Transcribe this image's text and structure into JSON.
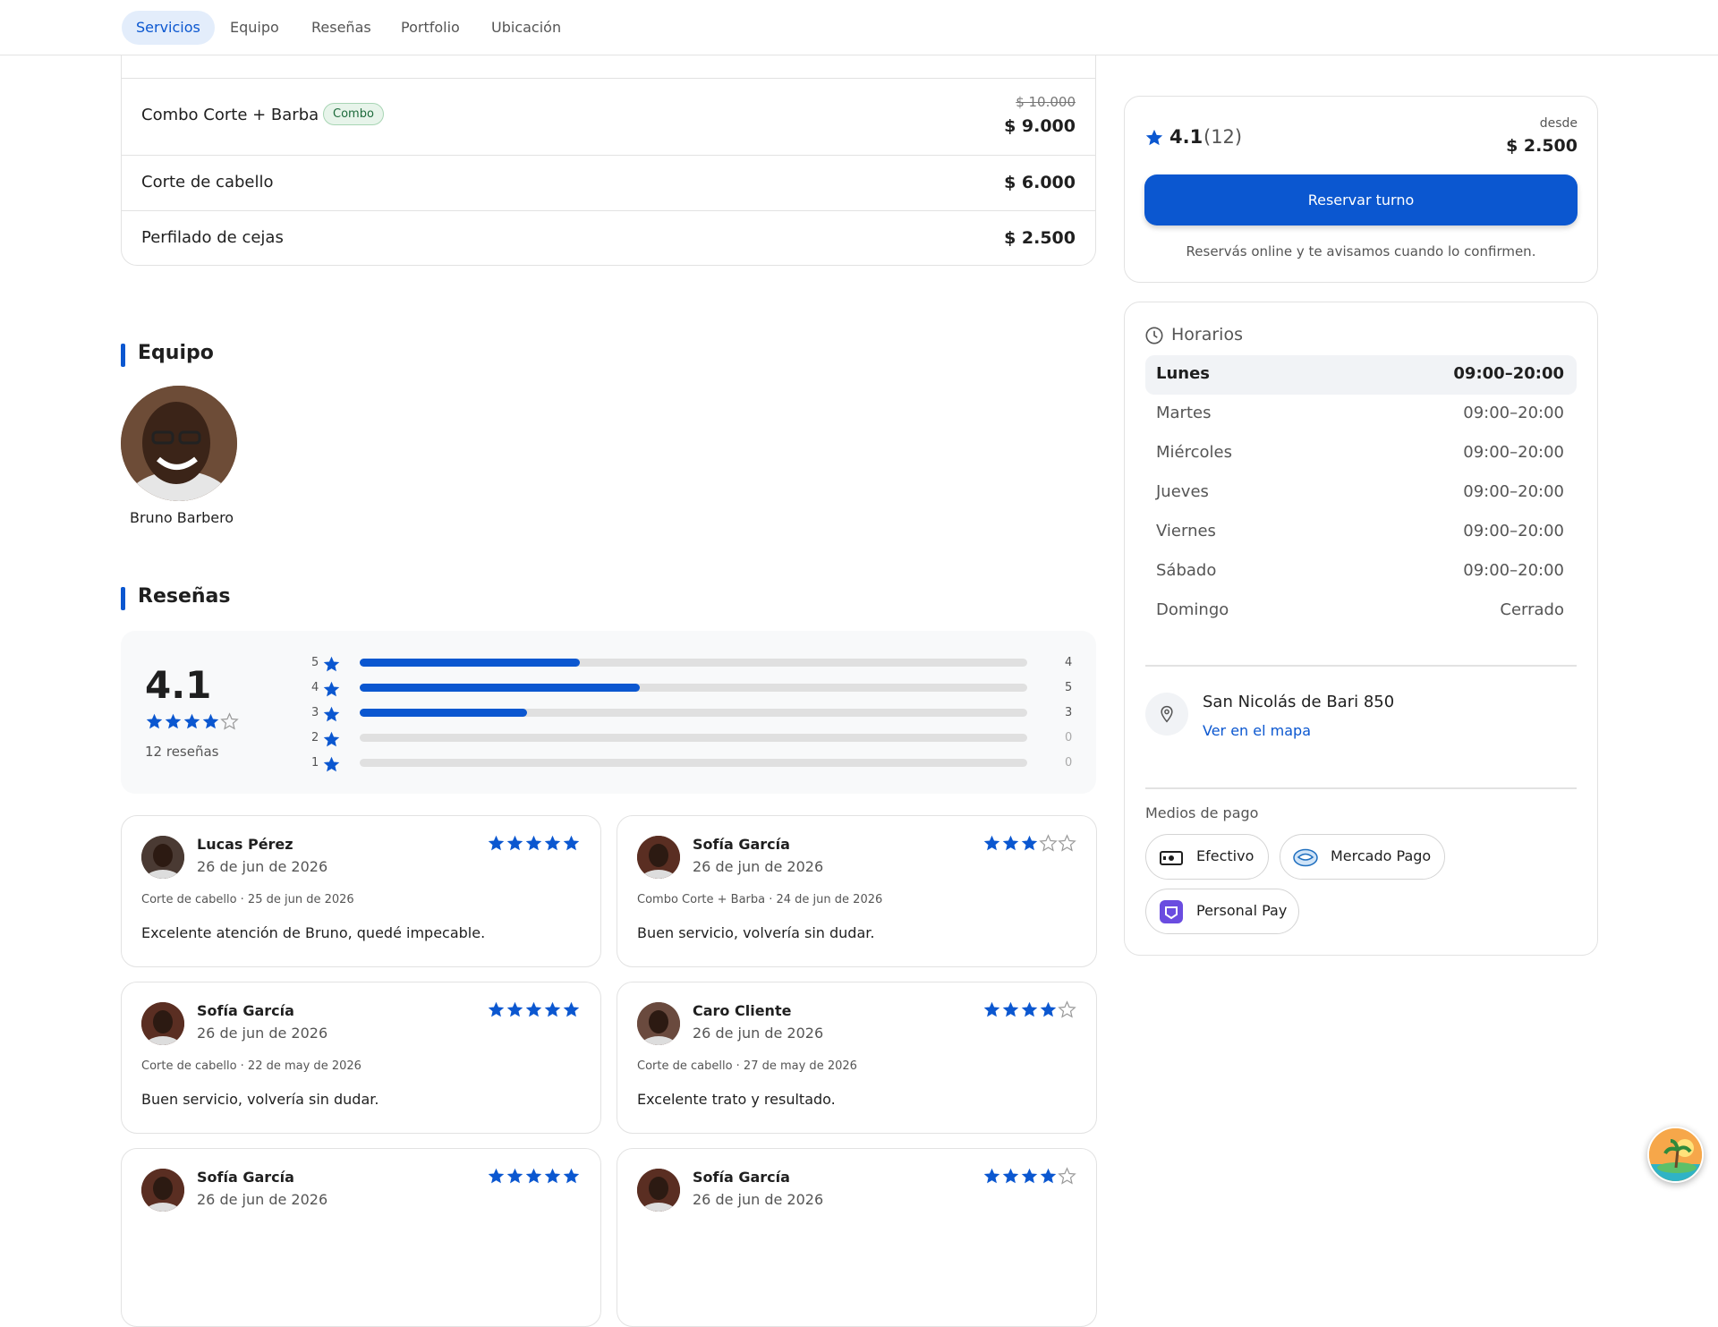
{
  "nav": {
    "tabs": [
      {
        "label": "Servicios",
        "active": true
      },
      {
        "label": "Equipo"
      },
      {
        "label": "Reseñas"
      },
      {
        "label": "Portfolio"
      },
      {
        "label": "Ubicación"
      }
    ]
  },
  "services": [
    {
      "name": "Combo Corte + Barba",
      "badge": "Combo",
      "old_price": "$ 10.000",
      "price": "$ 9.000"
    },
    {
      "name": "Corte de cabello",
      "price": "$ 6.000"
    },
    {
      "name": "Perfilado de cejas",
      "price": "$ 2.500"
    }
  ],
  "team": {
    "title": "Equipo",
    "members": [
      {
        "name": "Bruno Barbero"
      }
    ]
  },
  "reviews": {
    "title": "Reseñas",
    "average": "4.1",
    "average_stars": 4,
    "count_label": "12 reseñas",
    "distribution": [
      {
        "stars": "5",
        "count": "4",
        "fraction": 0.33
      },
      {
        "stars": "4",
        "count": "5",
        "fraction": 0.42
      },
      {
        "stars": "3",
        "count": "3",
        "fraction": 0.25
      },
      {
        "stars": "2",
        "count": "0",
        "fraction": 0
      },
      {
        "stars": "1",
        "count": "0",
        "fraction": 0
      }
    ],
    "items": [
      {
        "name": "Lucas Pérez",
        "date": "26 de jun de 2026",
        "meta": "Corte de cabello · 25 de jun de 2026",
        "text": "Excelente atención de Bruno, quedé impecable.",
        "rating": 5
      },
      {
        "name": "Sofía García",
        "date": "26 de jun de 2026",
        "meta": "Combo Corte + Barba · 24 de jun de 2026",
        "text": "Buen servicio, volvería sin dudar.",
        "rating": 3
      },
      {
        "name": "Sofía García",
        "date": "26 de jun de 2026",
        "meta": "Corte de cabello · 22 de may de 2026",
        "text": "Buen servicio, volvería sin dudar.",
        "rating": 5
      },
      {
        "name": "Caro Cliente",
        "date": "26 de jun de 2026",
        "meta": "Corte de cabello · 27 de may de 2026",
        "text": "Excelente trato y resultado.",
        "rating": 4
      },
      {
        "name": "Sofía García",
        "date": "26 de jun de 2026",
        "rating": 5
      },
      {
        "name": "Sofía García",
        "date": "26 de jun de 2026",
        "rating": 4
      }
    ]
  },
  "booking": {
    "rating": "4.1",
    "rating_count": "(12)",
    "from_label": "desde",
    "from_price": "$ 2.500",
    "button": "Reservar turno",
    "note": "Reservás online y te avisamos cuando lo confirmen."
  },
  "hours": {
    "title": "Horarios",
    "days": [
      {
        "day": "Lunes",
        "time": "09:00–20:00",
        "today": true
      },
      {
        "day": "Martes",
        "time": "09:00–20:00"
      },
      {
        "day": "Miércoles",
        "time": "09:00–20:00"
      },
      {
        "day": "Jueves",
        "time": "09:00–20:00"
      },
      {
        "day": "Viernes",
        "time": "09:00–20:00"
      },
      {
        "day": "Sábado",
        "time": "09:00–20:00"
      },
      {
        "day": "Domingo",
        "time": "Cerrado"
      }
    ]
  },
  "location": {
    "address": "San Nicolás de Bari 850",
    "map_link": "Ver en el mapa"
  },
  "payments": {
    "title": "Medios de pago",
    "methods": [
      {
        "label": "Efectivo",
        "icon": "cash-icon"
      },
      {
        "label": "Mercado Pago",
        "icon": "mercado-pago-icon"
      },
      {
        "label": "Personal Pay",
        "icon": "personal-pay-icon"
      }
    ]
  },
  "colors": {
    "accent": "#0b57d0",
    "star": "#0b57d0",
    "badge_green": "#1e6b3c"
  }
}
